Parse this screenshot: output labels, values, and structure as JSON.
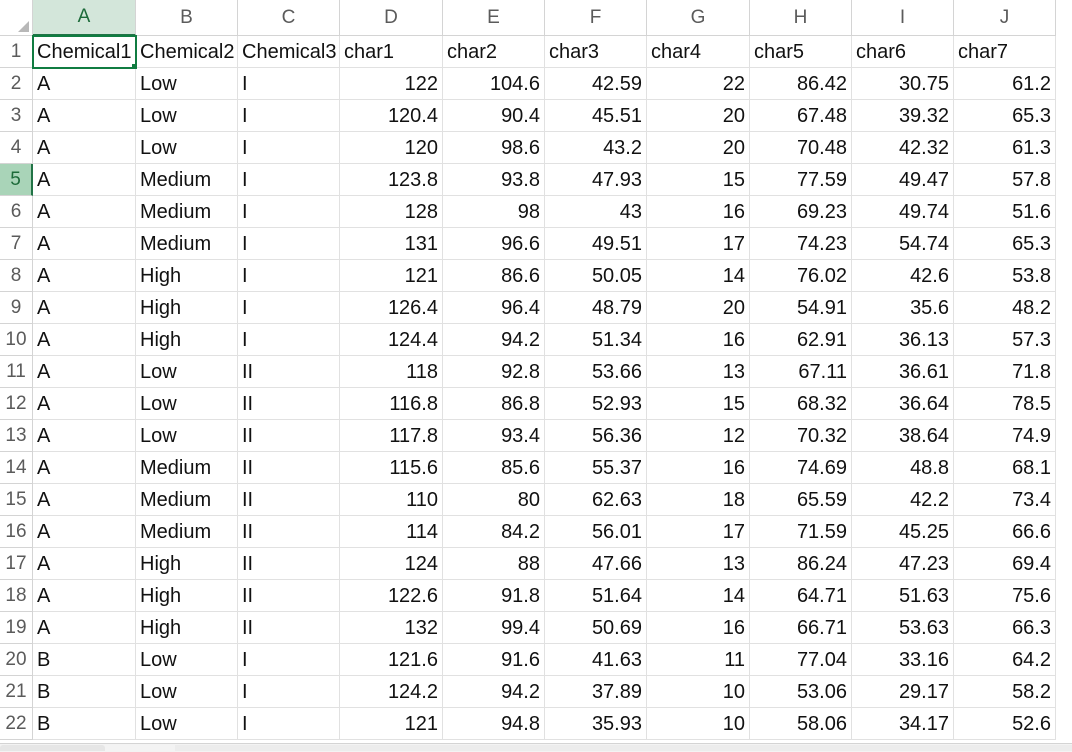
{
  "grid": {
    "columns": [
      "A",
      "B",
      "C",
      "D",
      "E",
      "F",
      "G",
      "H",
      "I",
      "J"
    ],
    "selected_column": "A",
    "selected_row": 5,
    "rows": [
      {
        "num": 1,
        "cells": [
          "Chemical1",
          "Chemical2",
          "Chemical3",
          "char1",
          "char2",
          "char3",
          "char4",
          "char5",
          "char6",
          "char7"
        ]
      },
      {
        "num": 2,
        "cells": [
          "A",
          "Low",
          "I",
          "122",
          "104.6",
          "42.59",
          "22",
          "86.42",
          "30.75",
          "61.2"
        ]
      },
      {
        "num": 3,
        "cells": [
          "A",
          "Low",
          "I",
          "120.4",
          "90.4",
          "45.51",
          "20",
          "67.48",
          "39.32",
          "65.3"
        ]
      },
      {
        "num": 4,
        "cells": [
          "A",
          "Low",
          "I",
          "120",
          "98.6",
          "43.2",
          "20",
          "70.48",
          "42.32",
          "61.3"
        ]
      },
      {
        "num": 5,
        "cells": [
          "A",
          "Medium",
          "I",
          "123.8",
          "93.8",
          "47.93",
          "15",
          "77.59",
          "49.47",
          "57.8"
        ]
      },
      {
        "num": 6,
        "cells": [
          "A",
          "Medium",
          "I",
          "128",
          "98",
          "43",
          "16",
          "69.23",
          "49.74",
          "51.6"
        ]
      },
      {
        "num": 7,
        "cells": [
          "A",
          "Medium",
          "I",
          "131",
          "96.6",
          "49.51",
          "17",
          "74.23",
          "54.74",
          "65.3"
        ]
      },
      {
        "num": 8,
        "cells": [
          "A",
          "High",
          "I",
          "121",
          "86.6",
          "50.05",
          "14",
          "76.02",
          "42.6",
          "53.8"
        ]
      },
      {
        "num": 9,
        "cells": [
          "A",
          "High",
          "I",
          "126.4",
          "96.4",
          "48.79",
          "20",
          "54.91",
          "35.6",
          "48.2"
        ]
      },
      {
        "num": 10,
        "cells": [
          "A",
          "High",
          "I",
          "124.4",
          "94.2",
          "51.34",
          "16",
          "62.91",
          "36.13",
          "57.3"
        ]
      },
      {
        "num": 11,
        "cells": [
          "A",
          "Low",
          "II",
          "118",
          "92.8",
          "53.66",
          "13",
          "67.11",
          "36.61",
          "71.8"
        ]
      },
      {
        "num": 12,
        "cells": [
          "A",
          "Low",
          "II",
          "116.8",
          "86.8",
          "52.93",
          "15",
          "68.32",
          "36.64",
          "78.5"
        ]
      },
      {
        "num": 13,
        "cells": [
          "A",
          "Low",
          "II",
          "117.8",
          "93.4",
          "56.36",
          "12",
          "70.32",
          "38.64",
          "74.9"
        ]
      },
      {
        "num": 14,
        "cells": [
          "A",
          "Medium",
          "II",
          "115.6",
          "85.6",
          "55.37",
          "16",
          "74.69",
          "48.8",
          "68.1"
        ]
      },
      {
        "num": 15,
        "cells": [
          "A",
          "Medium",
          "II",
          "110",
          "80",
          "62.63",
          "18",
          "65.59",
          "42.2",
          "73.4"
        ]
      },
      {
        "num": 16,
        "cells": [
          "A",
          "Medium",
          "II",
          "114",
          "84.2",
          "56.01",
          "17",
          "71.59",
          "45.25",
          "66.6"
        ]
      },
      {
        "num": 17,
        "cells": [
          "A",
          "High",
          "II",
          "124",
          "88",
          "47.66",
          "13",
          "86.24",
          "47.23",
          "69.4"
        ]
      },
      {
        "num": 18,
        "cells": [
          "A",
          "High",
          "II",
          "122.6",
          "91.8",
          "51.64",
          "14",
          "64.71",
          "51.63",
          "75.6"
        ]
      },
      {
        "num": 19,
        "cells": [
          "A",
          "High",
          "II",
          "132",
          "99.4",
          "50.69",
          "16",
          "66.71",
          "53.63",
          "66.3"
        ]
      },
      {
        "num": 20,
        "cells": [
          "B",
          "Low",
          "I",
          "121.6",
          "91.6",
          "41.63",
          "11",
          "77.04",
          "33.16",
          "64.2"
        ]
      },
      {
        "num": 21,
        "cells": [
          "B",
          "Low",
          "I",
          "124.2",
          "94.2",
          "37.89",
          "10",
          "53.06",
          "29.17",
          "58.2"
        ]
      },
      {
        "num": 22,
        "cells": [
          "B",
          "Low",
          "I",
          "121",
          "94.8",
          "35.93",
          "10",
          "58.06",
          "34.17",
          "52.6"
        ]
      }
    ]
  },
  "colors": {
    "accent": "#217346",
    "selected_header_bg": "#d3e6da",
    "selected_row_header_bg": "#a9d4b8"
  }
}
